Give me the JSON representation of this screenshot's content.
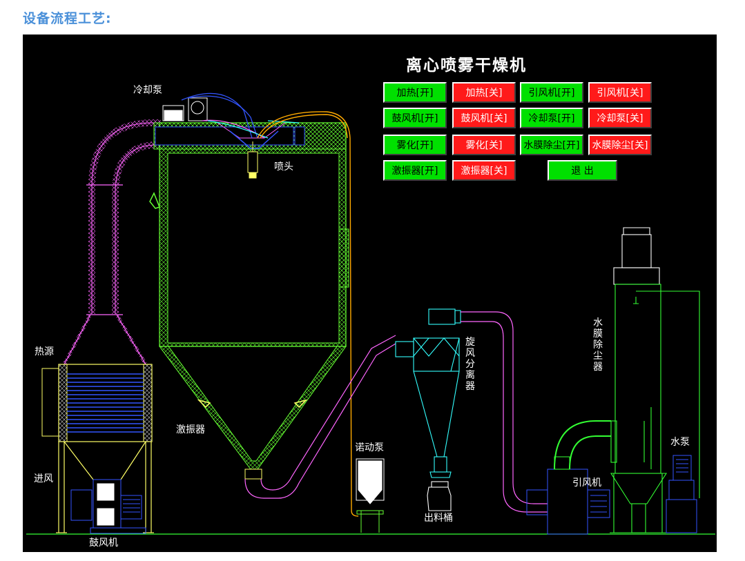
{
  "page": {
    "heading": "设备流程工艺:"
  },
  "hmi": {
    "title": "离心喷雾干燥机",
    "buttons": {
      "heat_on": "加热[开]",
      "heat_off": "加热[关]",
      "induced_fan_on": "引风机[开]",
      "induced_fan_off": "引风机[关]",
      "blower_on": "鼓风机[开]",
      "blower_off": "鼓风机[关]",
      "cool_pump_on": "冷却泵[开]",
      "cool_pump_off": "冷却泵[关]",
      "atomize_on": "雾化[开]",
      "atomize_off": "雾化[关]",
      "film_dust_on": "水膜除尘[开]",
      "film_dust_off": "水膜除尘[关]",
      "vibrator_on": "激振器[开]",
      "vibrator_off": "激振器[关]",
      "exit": "退 出"
    },
    "labels": {
      "cooling_pump": "冷却泵",
      "nozzle": "喷头",
      "heat_source": "热源",
      "vibrator": "激振器",
      "air_inlet": "进风",
      "blower": "鼓风机",
      "mono_pump": "诺动泵",
      "cyclone": "旋风分离器",
      "collection_drum": "出料桶",
      "induced_fan": "引风机",
      "water_film_dust": "水膜除尘器",
      "water_pump": "水泵"
    },
    "colors": {
      "on": "#00e000",
      "off": "#ff1a1a",
      "duct": "#ff66ff",
      "wall": "#66ff33",
      "cyclone": "#33ffff",
      "feed_line": "#ffaa00"
    }
  }
}
